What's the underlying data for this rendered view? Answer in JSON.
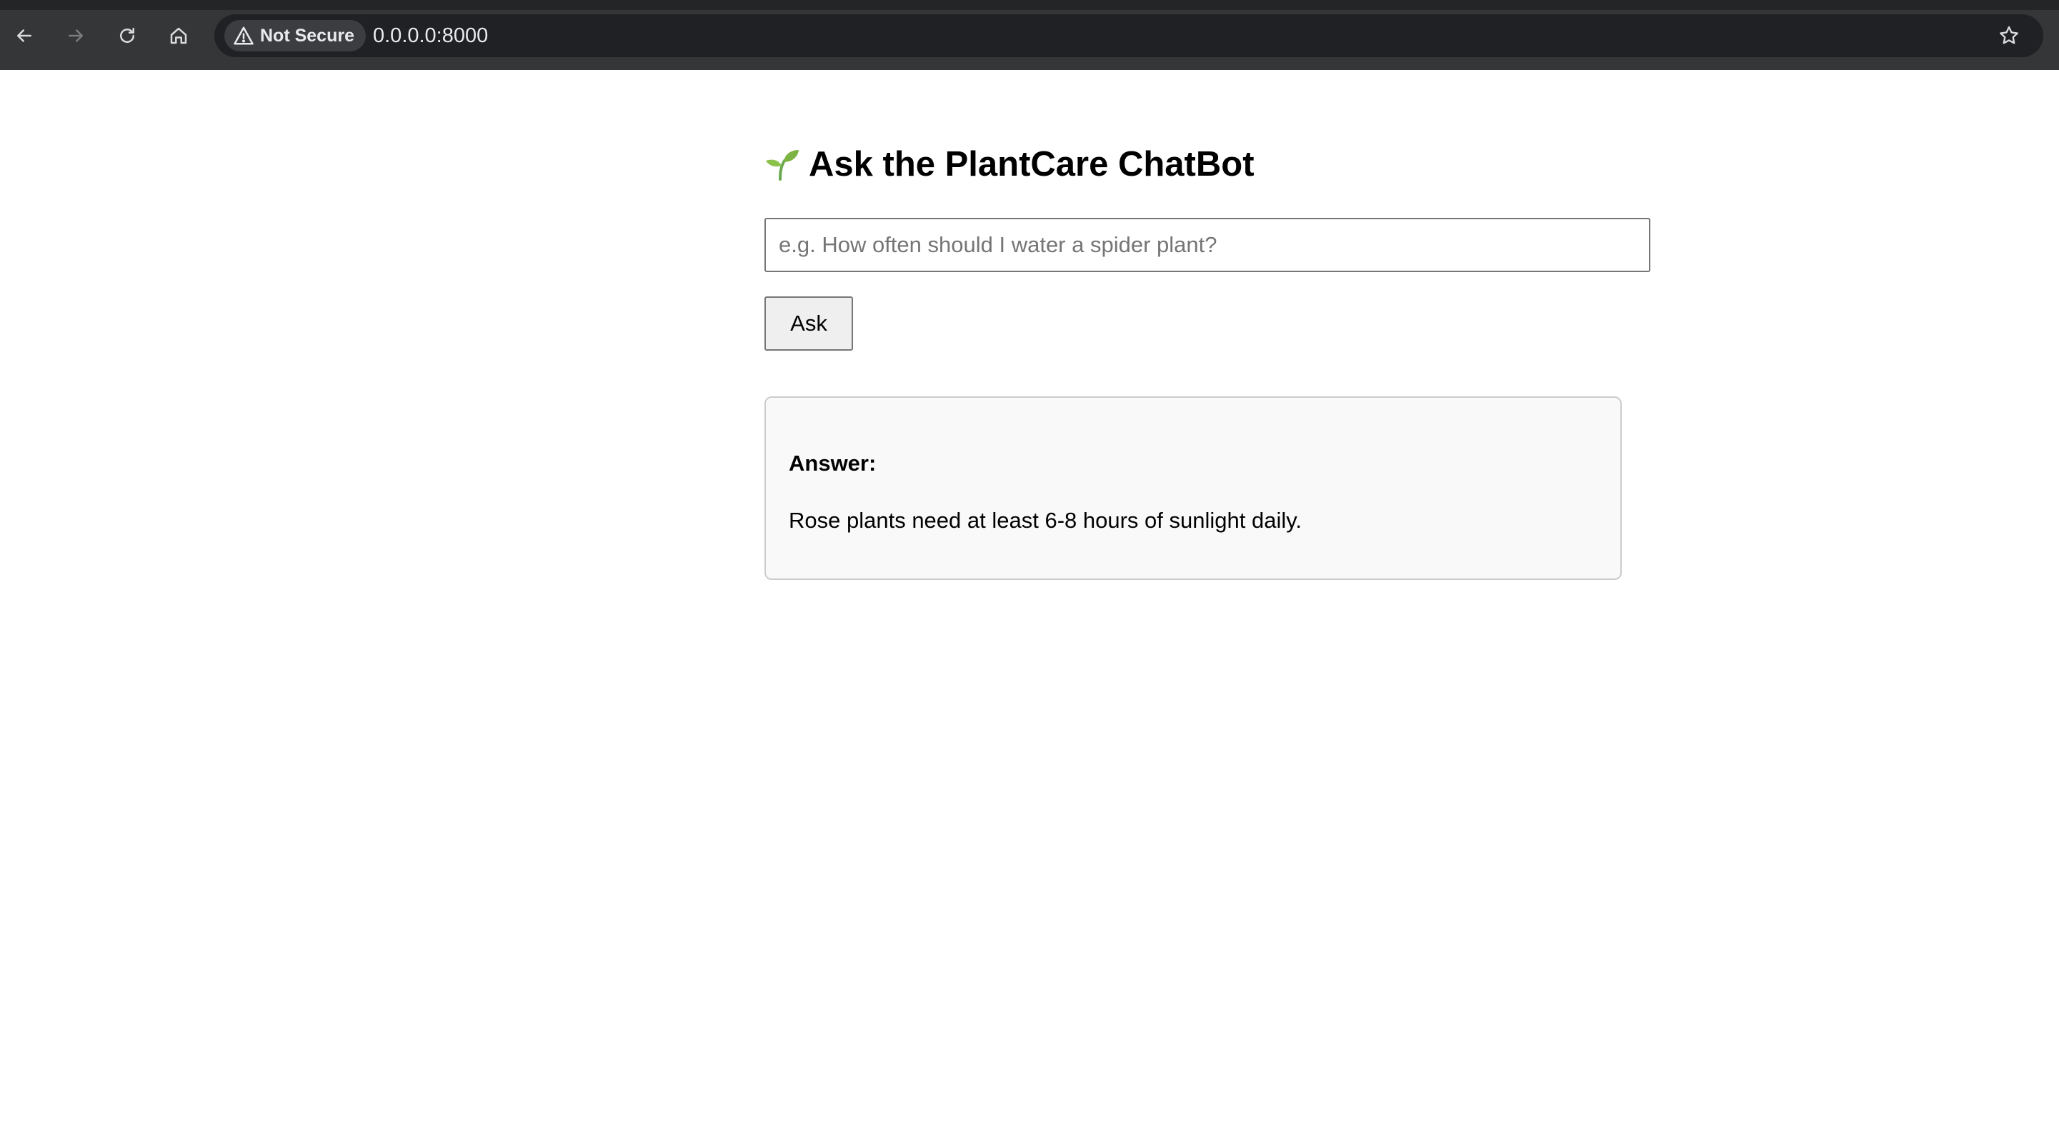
{
  "browser": {
    "security_label": "Not Secure",
    "url": "0.0.0.0:8000",
    "icons": [
      "back-arrow-icon",
      "forward-arrow-icon",
      "reload-icon",
      "home-icon",
      "warning-triangle-icon",
      "star-icon"
    ]
  },
  "page": {
    "title": "Ask the PlantCare ChatBot",
    "title_icon": "sprout-icon",
    "input_placeholder": "e.g. How often should I water a spider plant?",
    "input_value": "",
    "ask_label": "Ask",
    "answer_label": "Answer:",
    "answer_text": "Rose plants need at least 6-8 hours of sunlight daily."
  },
  "colors": {
    "browser_chrome": "#353638",
    "omnibox": "#202124",
    "sprout_green": "#6aa84f",
    "answer_bg": "#f9f9f9",
    "answer_border": "#cccccc"
  }
}
